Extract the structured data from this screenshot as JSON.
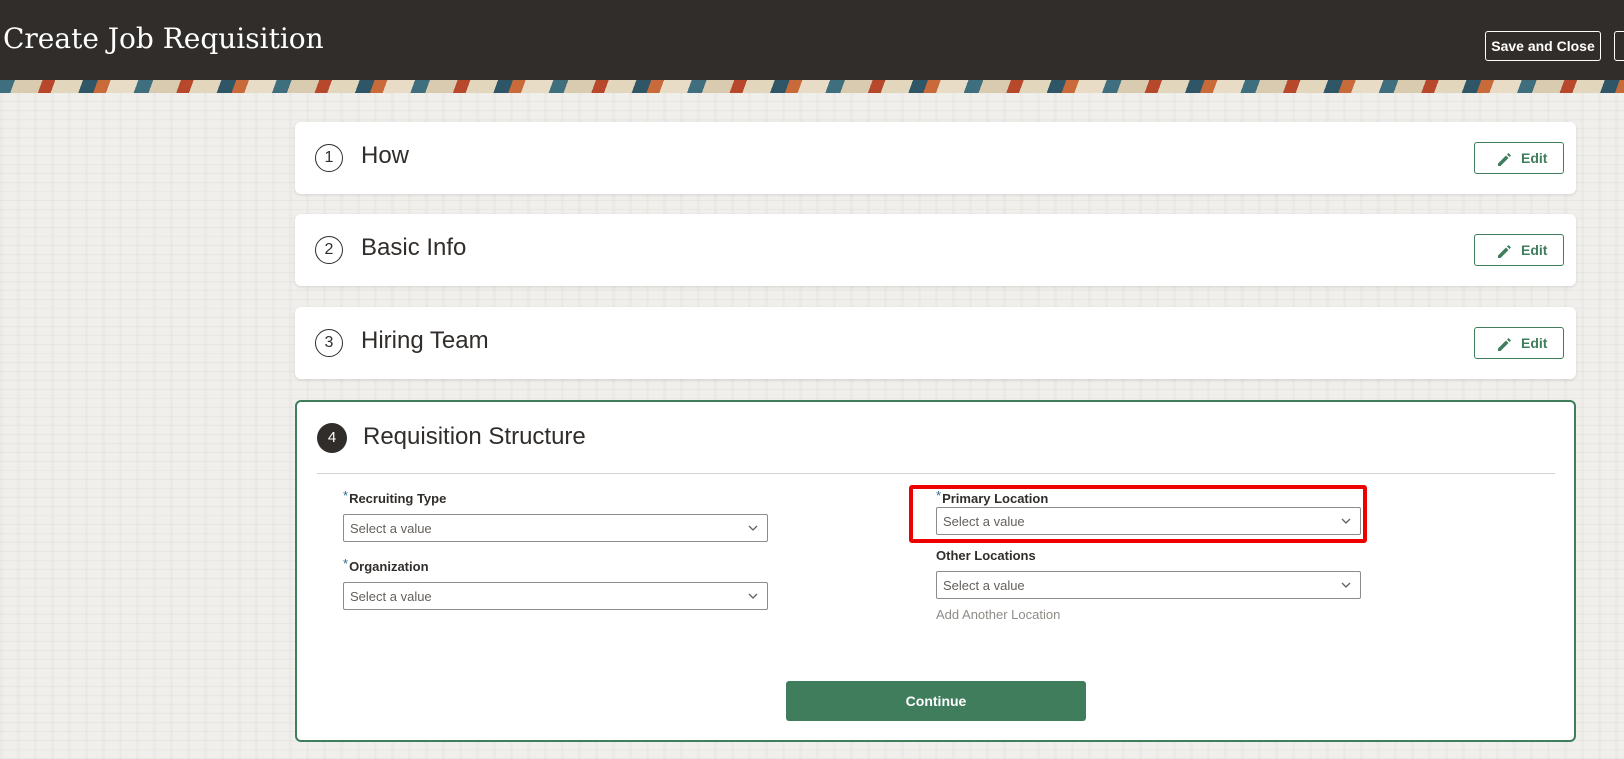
{
  "header": {
    "title": "Create Job Requisition",
    "save_close_label": "Save and Close"
  },
  "steps": [
    {
      "number": "1",
      "title": "How",
      "edit_label": "Edit"
    },
    {
      "number": "2",
      "title": "Basic Info",
      "edit_label": "Edit"
    },
    {
      "number": "3",
      "title": "Hiring Team",
      "edit_label": "Edit"
    }
  ],
  "active_step": {
    "number": "4",
    "title": "Requisition Structure",
    "required_marker": "*",
    "fields": {
      "recruiting_type": {
        "label": "Recruiting Type",
        "value": "Select a value"
      },
      "organization": {
        "label": "Organization",
        "value": "Select a value"
      },
      "primary_location": {
        "label": "Primary Location",
        "value": "Select a value"
      },
      "other_locations": {
        "label": "Other Locations",
        "value": "Select a value"
      }
    },
    "add_location_label": "Add Another Location",
    "continue_label": "Continue"
  },
  "colors": {
    "header_bg": "#312d2a",
    "accent_green": "#3f7d5d",
    "highlight_red": "#ee0000",
    "required_blue": "#2d6a8a"
  },
  "icons": {
    "edit": "pencil-icon",
    "dropdown": "chevron-down-icon"
  }
}
